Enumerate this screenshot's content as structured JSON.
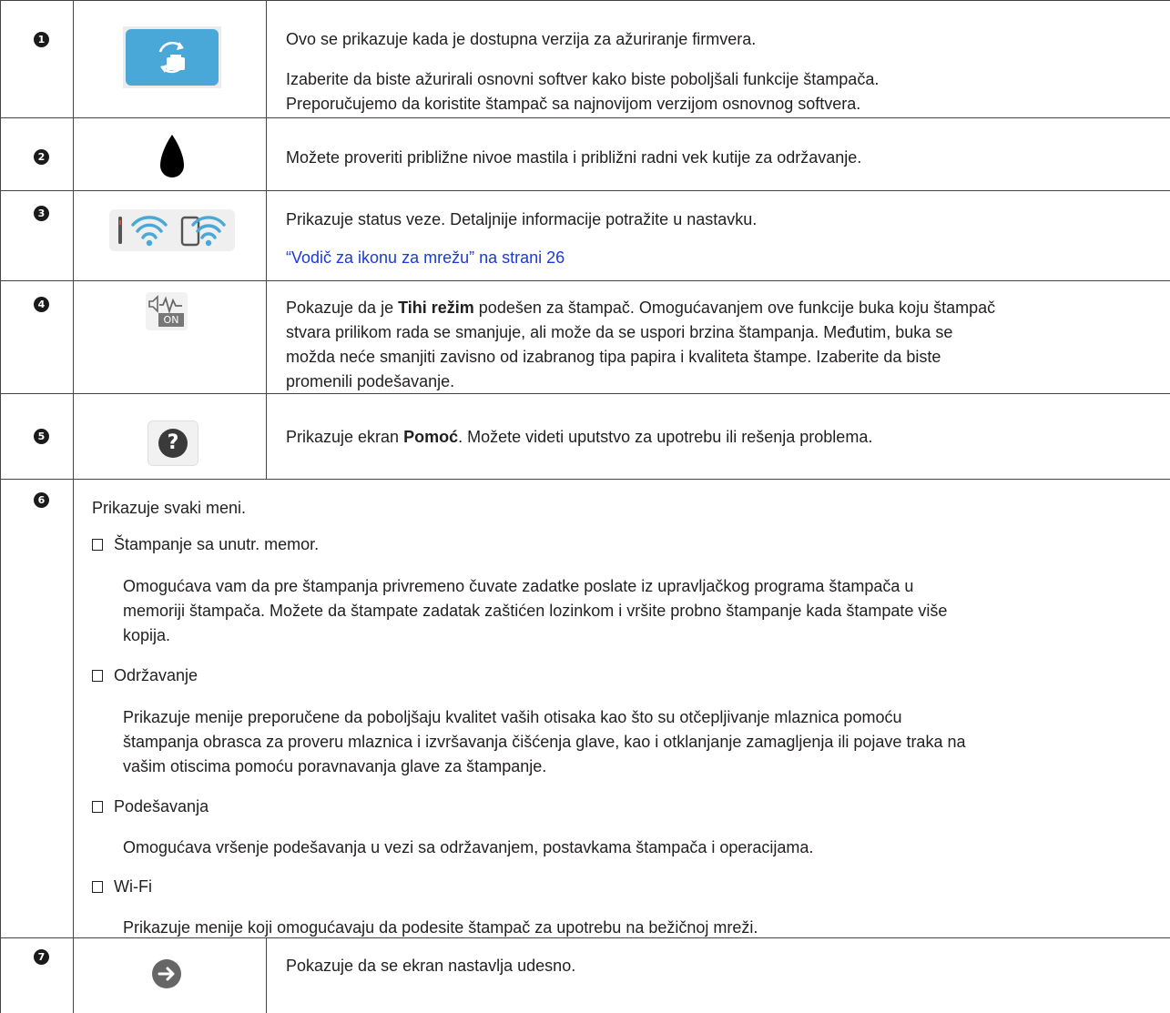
{
  "rows": [
    {
      "number": "1",
      "icon": "firmware-update-icon",
      "paragraphs": [
        "Ovo se prikazuje kada je dostupna verzija za ažuriranje firmvera.",
        "Izaberite da biste ažurirali osnovni softver kako biste poboljšali funkcije štampača.",
        "Preporučujemo da koristite štampač sa najnovijom verzijom osnovnog softvera."
      ]
    },
    {
      "number": "2",
      "icon": "ink-drop-icon",
      "paragraphs": [
        "Možete proveriti približne nivoe mastila i približni radni vek kutije za održavanje."
      ]
    },
    {
      "number": "3",
      "icon": "network-status-icon",
      "paragraphs": [
        "Prikazuje status veze. Detaljnije informacije potražite u nastavku."
      ],
      "link": "“Vodič za ikonu za mrežu” na strani 26"
    },
    {
      "number": "4",
      "icon": "quiet-mode-icon",
      "lines": [
        {
          "pre": "Pokazuje da je ",
          "bold": "Tihi režim",
          "post": " podešen za štampač. Omogućavanjem ove funkcije buka koju štampač"
        },
        {
          "pre": "stvara prilikom rada se smanjuje, ali može da se uspori brzina štampanja. Međutim, buka se"
        },
        {
          "pre": "možda neće smanjiti zavisno od izabranog tipa papira i kvaliteta štampe. Izaberite da biste"
        },
        {
          "pre": "promenili podešavanje."
        }
      ]
    },
    {
      "number": "5",
      "icon": "help-icon",
      "lines": [
        {
          "pre": "Prikazuje ekran ",
          "bold": "Pomoć",
          "post": ". Možete videti uputstvo za upotrebu ili rešenja problema."
        }
      ]
    },
    {
      "number": "6",
      "intro": "Prikazuje svaki meni.",
      "items": [
        {
          "title": "Štampanje sa unutr. memor.",
          "desc": [
            "Omogućava vam da pre štampanja privremeno čuvate zadatke poslate iz upravljačkog programa štampača u",
            "memoriji štampača. Možete da štampate zadatak zaštićen lozinkom i vršite probno štampanje kada štampate više",
            "kopija."
          ]
        },
        {
          "title": "Održavanje",
          "desc": [
            "Prikazuje menije preporučene da poboljšaju kvalitet vaših otisaka kao što su otčepljivanje mlaznica pomoću",
            "štampanja obrasca za proveru mlaznica i izvršavanja čišćenja glave, kao i otklanjanje zamagljenja ili pojave traka na",
            "vašim otiscima pomoću poravnavanja glave za štampanje."
          ]
        },
        {
          "title": "Podešavanja",
          "desc": [
            "Omogućava vršenje podešavanja u vezi sa održavanjem, postavkama štampača i operacijama."
          ]
        },
        {
          "title": "Wi-Fi",
          "desc": [
            "Prikazuje menije koji omogućavaju da podesite štampač za upotrebu na bežičnoj mreži."
          ]
        }
      ]
    },
    {
      "number": "7",
      "icon": "arrow-right-icon",
      "paragraphs": [
        "Pokazuje da se ekran nastavlja udesno."
      ]
    }
  ],
  "colors": {
    "icon_blue": "#4aa8d8",
    "icon_gray": "#666666",
    "link": "#1a3bd6",
    "border": "#444444"
  }
}
